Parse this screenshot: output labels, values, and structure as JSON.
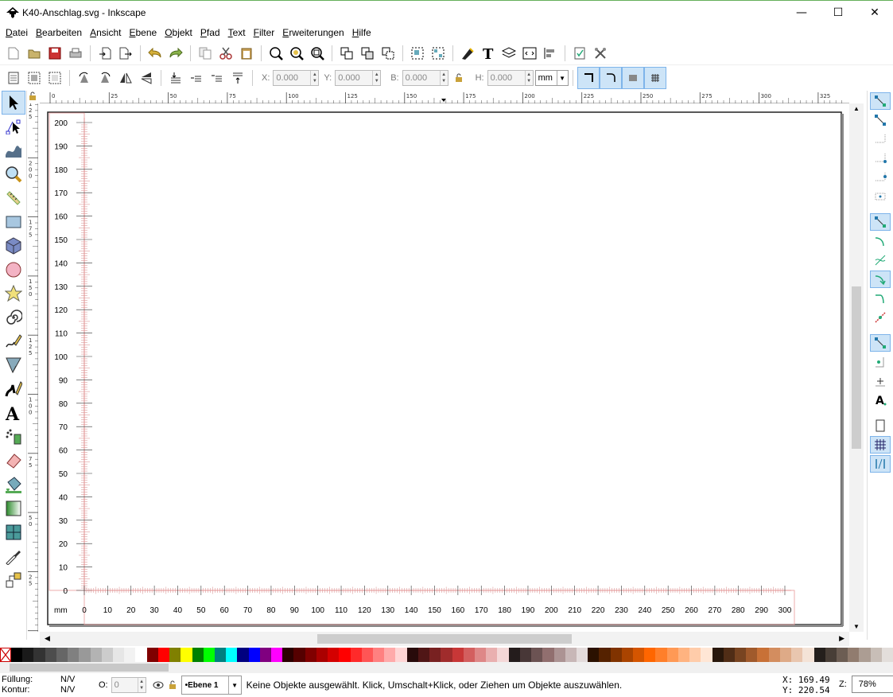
{
  "window": {
    "title": "K40-Anschlag.svg - Inkscape",
    "minimize": "—",
    "maximize": "☐",
    "close": "✕"
  },
  "menu": [
    "Datei",
    "Bearbeiten",
    "Ansicht",
    "Ebene",
    "Objekt",
    "Pfad",
    "Text",
    "Filter",
    "Erweiterungen",
    "Hilfe"
  ],
  "controls": {
    "x_label": "X:",
    "x_value": "0.000",
    "y_label": "Y:",
    "y_value": "0.000",
    "w_label": "B:",
    "w_value": "0.000",
    "h_label": "H:",
    "h_value": "0.000",
    "unit": "mm"
  },
  "ruler_top_labels": [
    "0",
    "25",
    "50",
    "75",
    "100",
    "125",
    "150",
    "175",
    "200",
    "225",
    "250",
    "275",
    "300",
    "325"
  ],
  "ruler_left_labels": [
    "1 2 5",
    "2 0 0",
    "1 7 5",
    "1 5 0",
    "1 2 5",
    "1 0 0",
    "7 5",
    "5 0",
    "2 5",
    "0"
  ],
  "drawing": {
    "y_labels": [
      "200",
      "190",
      "180",
      "170",
      "160",
      "150",
      "140",
      "130",
      "120",
      "110",
      "100",
      "90",
      "80",
      "70",
      "60",
      "50",
      "40",
      "30",
      "20",
      "10",
      "0"
    ],
    "x_labels": [
      "0",
      "10",
      "20",
      "30",
      "40",
      "50",
      "60",
      "70",
      "80",
      "90",
      "100",
      "110",
      "120",
      "130",
      "140",
      "150",
      "160",
      "170",
      "180",
      "190",
      "200",
      "210",
      "220",
      "230",
      "240",
      "250",
      "260",
      "270",
      "280",
      "290",
      "300"
    ],
    "unit_label": "mm"
  },
  "palette": [
    "#000000",
    "#1a1a1a",
    "#333333",
    "#4d4d4d",
    "#666666",
    "#808080",
    "#999999",
    "#b3b3b3",
    "#cccccc",
    "#e6e6e6",
    "#f2f2f2",
    "#ffffff",
    "#800000",
    "#ff0000",
    "#808000",
    "#ffff00",
    "#008000",
    "#00ff00",
    "#008080",
    "#00ffff",
    "#000080",
    "#0000ff",
    "#800080",
    "#ff00ff",
    "#2b0000",
    "#550000",
    "#800000",
    "#aa0000",
    "#d40000",
    "#ff0000",
    "#ff2a2a",
    "#ff5555",
    "#ff8080",
    "#ffaaaa",
    "#ffd5d5",
    "#280b0b",
    "#501616",
    "#782121",
    "#a02c2c",
    "#c83737",
    "#d35f5f",
    "#de8787",
    "#e9afaf",
    "#f4d7d7",
    "#241c1c",
    "#483737",
    "#6c5353",
    "#916f6f",
    "#ac9393",
    "#c8b7b7",
    "#e3dbdb",
    "#2b1100",
    "#552200",
    "#803300",
    "#aa4400",
    "#d45500",
    "#ff6600",
    "#ff7f2a",
    "#ff9955",
    "#ffb380",
    "#ffccaa",
    "#ffe6d5",
    "#28170b",
    "#502d16",
    "#784421",
    "#a05a2c",
    "#c87137",
    "#d38d5f",
    "#deaa87",
    "#e9c6af",
    "#f4e3d7",
    "#241f1c",
    "#483e37",
    "#6c5d53",
    "#917c6f",
    "#ac9d93",
    "#c8beb7",
    "#e3dedb"
  ],
  "status": {
    "fill_label": "Füllung:",
    "fill_value": "N/V",
    "stroke_label": "Kontur:",
    "stroke_value": "N/V",
    "opacity_label": "O:",
    "opacity_value": "0",
    "layer": "•Ebene 1",
    "message": "Keine Objekte ausgewählt. Klick, Umschalt+Klick, oder Ziehen um Objekte auszuwählen.",
    "x_coord": "X:  169.49",
    "y_coord": "Y:  220.54",
    "zoom_label": "Z:",
    "zoom_value": "78%"
  }
}
